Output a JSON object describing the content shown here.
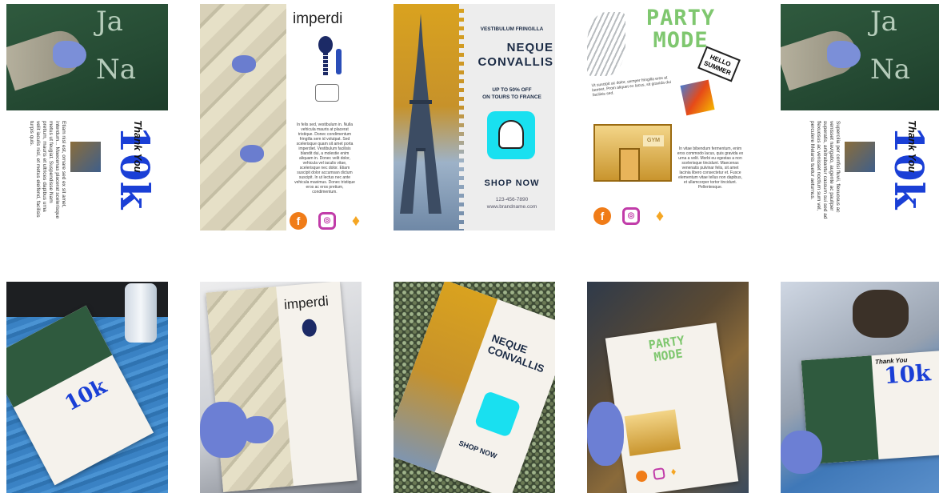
{
  "flyers": {
    "thankyou": {
      "thanks_text": "Thank You",
      "big_text": "10k",
      "chalk_left": "Ja",
      "chalk_right": "Na",
      "body_text": "Etiam nisl est, ornare sed ex sit amet, interdum... Maecenas placerat scelerisque metus ut feugiat. Suspendisse Nam pretium, mauris et ultrices dapibus urna velit iaculis nisl, et metus eleifend, facilisis turpis quis.",
      "body_text_alt": "Supercilia per confisi fluvii, flexuosus ac venisset navigatio, augente ac pauliper superatis, arbitrabantur cassum sui sed ad flexuosus ac venisset noctium sum vel, perculere Melanis tuetur aeturnus."
    },
    "imperdi": {
      "title": "imperdi",
      "body_text": "In felis sed, vestibulum in. Nulla vehicula mauris at placerat tristique. Donec condimentum fringilla sem id volutpat. Sed scelerisque quam sit amet porta imperdiet. Vestibulum facilisis blandit dui, a molestie enim aliquam in. Donec velit dolor, vehicula vel iaculis vitae, scelerisque nec dolor. Etiam suscipit dolor accumsan dictum suscipit. In ut lectus nec ante vehicula maximus. Donec tristique eros ac eros pretium, condimentum."
    },
    "eiffel": {
      "kicker": "VESTIBULUM FRINGILLA",
      "headline_1": "NEQUE",
      "headline_2": "CONVALLIS",
      "offer_1": "UP TO 50% OFF",
      "offer_2": "ON TOURS TO FRANCE",
      "cta": "SHOP NOW",
      "phone": "123-456-7890",
      "website": "www.brandname.com"
    },
    "party": {
      "title_1": "PARTY",
      "title_2": "MODE",
      "sign_1": "HELLO",
      "sign_2": "SUMMER",
      "store_sign": "GYM",
      "top_text": "Ut suscipit ac dolor, semper fringilla eros at laoreet. Proin aliquet ex lacus, sit gravida dui facilisis sed.",
      "body_text": "In vitae bibendum fermentum, enim eros commodo lacus, quis gravida ex urna a velit. Morbi eu egestas a non scelerisque tincidunt. Maecenas venenatis pulvinar felis, sit amet lacinia libero consectetur et. Fusce elementum vitae tellus non dapibus, et ullamcorper tortor tincidunt. Pellentesque."
    }
  },
  "social_icons": [
    "facebook-icon",
    "instagram-icon",
    "twitter-icon"
  ],
  "colors": {
    "thank_blue": "#1a3fd6",
    "chalkboard": "#2f5a3e",
    "snap_cyan": "#19e0f0",
    "party_green": "#7fc76f",
    "eiffel_gold": "#d9a21f",
    "floor_blue": "#3a82c4"
  }
}
